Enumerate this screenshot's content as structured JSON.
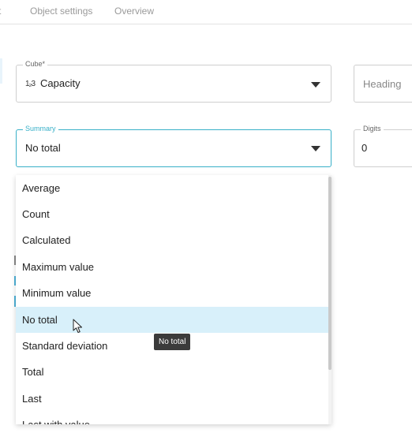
{
  "tabs": {
    "prev": "rt",
    "object_settings": "Object settings",
    "overview": "Overview"
  },
  "cube": {
    "label": "Cube*",
    "icon": "number-type-icon",
    "icon_text": "1₂3",
    "value": "Capacity"
  },
  "heading": {
    "placeholder": "Heading"
  },
  "summary": {
    "label": "Summary",
    "value": "No total"
  },
  "digits": {
    "label": "Digits",
    "value": "0"
  },
  "dropdown": {
    "options": [
      {
        "label": "Average"
      },
      {
        "label": "Count"
      },
      {
        "label": "Calculated"
      },
      {
        "label": "Maximum value"
      },
      {
        "label": "Minimum value"
      },
      {
        "label": "No total"
      },
      {
        "label": "Standard deviation"
      },
      {
        "label": "Total"
      },
      {
        "label": "Last"
      },
      {
        "label": "Last with value"
      }
    ],
    "selected": "No total"
  },
  "tooltip": {
    "text": "No total"
  },
  "colors": {
    "accent": "#38b0c8",
    "selected_bg": "#d8f0fa",
    "tooltip_bg": "#3b3b3b"
  }
}
